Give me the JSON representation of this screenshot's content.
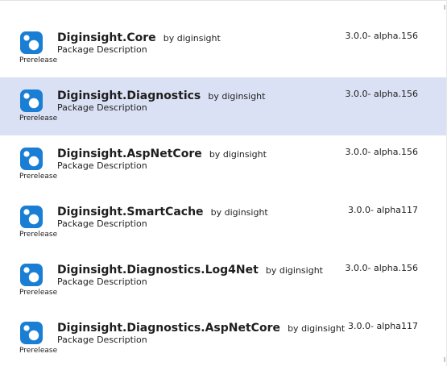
{
  "packages": [
    {
      "name": "Diginsight.Core",
      "author": "by diginsight",
      "description": "Package Description",
      "version": "3.0.0- alpha.156",
      "badge": "Prerelease",
      "icon": "nuget-package-icon"
    },
    {
      "name": "Diginsight.Diagnostics",
      "author": "by diginsight",
      "description": "Package Description",
      "version": "3.0.0- alpha.156",
      "badge": "Prerelease",
      "icon": "nuget-package-icon",
      "selected": true
    },
    {
      "name": "Diginsight.AspNetCore",
      "author": "by diginsight",
      "description": "Package Description",
      "version": "3.0.0- alpha.156",
      "badge": "Prerelease",
      "icon": "nuget-package-icon"
    },
    {
      "name": "Diginsight.SmartCache",
      "author": "by diginsight",
      "description": "Package Description",
      "version": "3.0.0- alpha117",
      "badge": "Prerelease",
      "icon": "nuget-package-icon"
    },
    {
      "name": "Diginsight.Diagnostics.Log4Net",
      "author": "by diginsight",
      "description": "Package Description",
      "version": "3.0.0- alpha.156",
      "badge": "Prerelease",
      "icon": "nuget-package-icon"
    },
    {
      "name": "Diginsight.Diagnostics.AspNetCore",
      "author": "by diginsight",
      "description": "Package Description",
      "version": "3.0.0- alpha117",
      "badge": "Prerelease",
      "icon": "nuget-package-icon"
    }
  ],
  "colors": {
    "selection": "#dbe1f4",
    "icon_blue": "#1a7fd4",
    "text": "#1e1e1e"
  }
}
